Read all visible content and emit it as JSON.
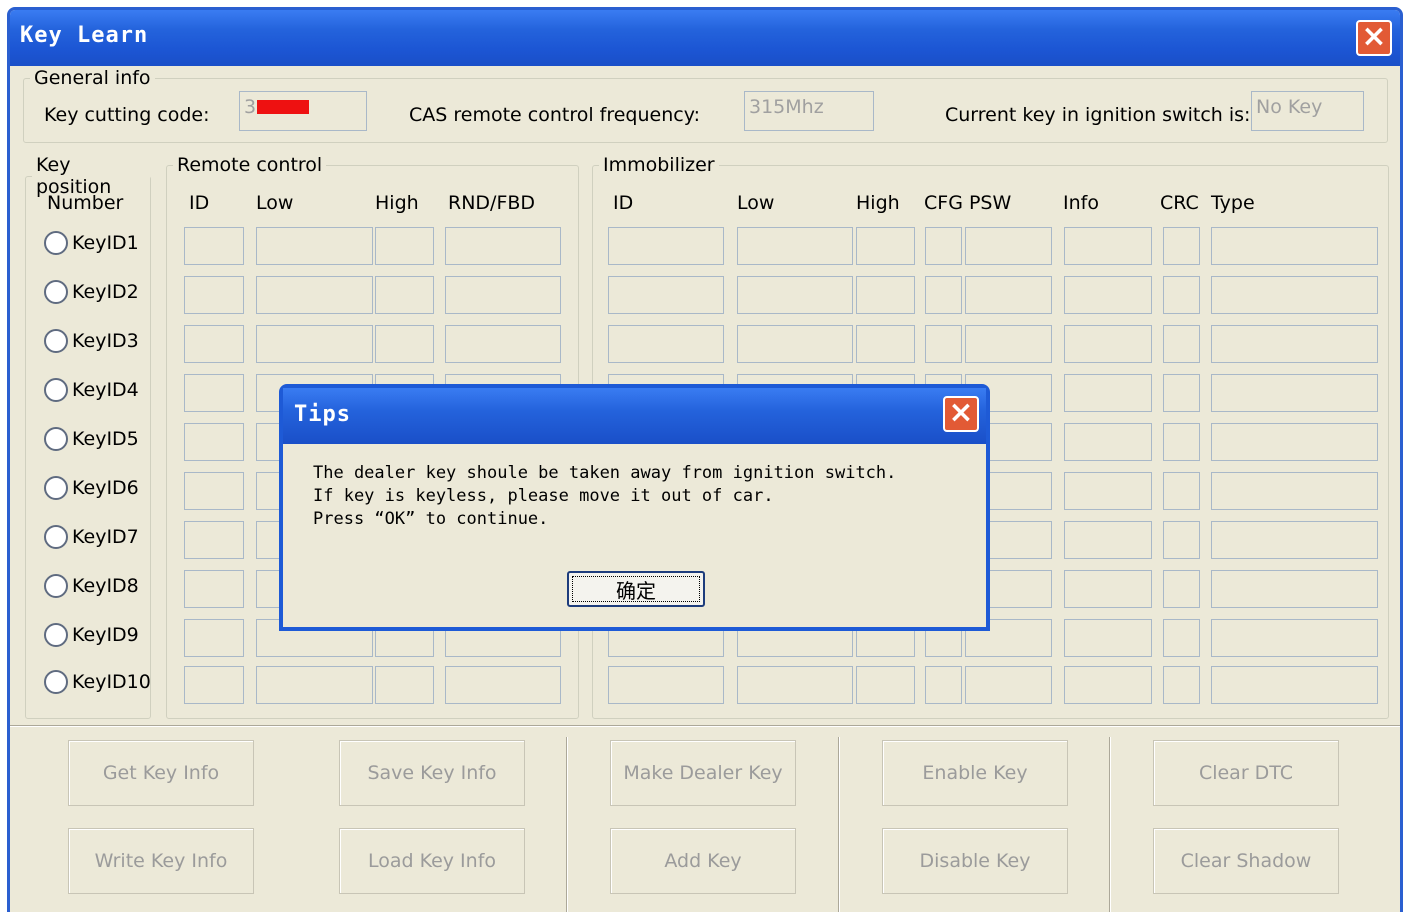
{
  "window": {
    "title": "Key Learn"
  },
  "general": {
    "legend": "General info",
    "cut_label": "Key cutting code:",
    "cut_value": "3",
    "freq_label": "CAS remote control frequency:",
    "freq_value": "315Mhz",
    "ign_label": "Current key in ignition switch is:",
    "ign_value": "No Key"
  },
  "keypos": {
    "legend": "Key position",
    "col": "Number",
    "keys": [
      "KeyID1",
      "KeyID2",
      "KeyID3",
      "KeyID4",
      "KeyID5",
      "KeyID6",
      "KeyID7",
      "KeyID8",
      "KeyID9",
      "KeyID10"
    ]
  },
  "remote": {
    "legend": "Remote control",
    "cols": [
      "ID",
      "Low",
      "High",
      "RND/FBD"
    ]
  },
  "immo": {
    "legend": "Immobilizer",
    "cols": [
      "ID",
      "Low",
      "High",
      "CFG PSW",
      "Info",
      "CRC",
      "Type"
    ]
  },
  "buttons": {
    "get": "Get Key Info",
    "save": "Save Key Info",
    "make": "Make Dealer Key",
    "enable": "Enable Key",
    "clear_dtc": "Clear DTC",
    "write": "Write Key Info",
    "load": "Load Key Info",
    "add": "Add Key",
    "disable": "Disable Key",
    "clear_shadow": "Clear Shadow"
  },
  "dialog": {
    "title": "Tips",
    "line1": "The dealer key shoule be taken away from ignition switch.",
    "line2": "If key is keyless, please move it out of car.",
    "line3": "Press “OK” to continue.",
    "ok": "确定"
  },
  "colors": {
    "titlebar": "#2463dc",
    "close": "#e25a35",
    "face": "#ece9d8",
    "redacted": "#ee1111"
  },
  "icons": {
    "close": "close-icon",
    "radio": "radio-icon"
  }
}
